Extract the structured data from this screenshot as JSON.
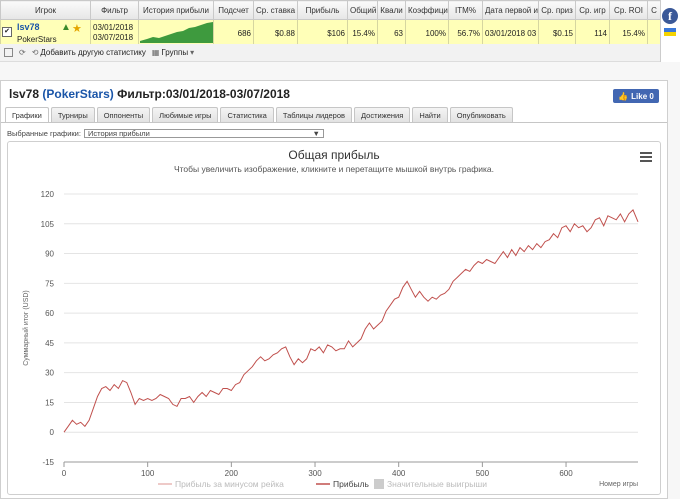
{
  "stats_table": {
    "headers": [
      "Игрок",
      "Фильтр",
      "История прибыли",
      "Подсчет",
      "Ср. ставка",
      "Прибыль",
      "Общий",
      "Квали",
      "Коэффици",
      "ITM%",
      "Дата первой и",
      "Ср. приз",
      "Ср. игр",
      "Ср. ROI",
      "С"
    ],
    "row": {
      "player_name": "lsv78",
      "player_room": "PokerStars",
      "filter_from": "03/01/2018",
      "filter_to": "03/07/2018",
      "count": "686",
      "avg_stake": "$0.88",
      "profit": "$106",
      "total": "15.4%",
      "quali": "63",
      "ratio": "100%",
      "itm": "56.7%",
      "first_date": "03/01/2018 03",
      "avg_prize": "$0.15",
      "avg_games": "114",
      "avg_roi": "15.4%"
    }
  },
  "toolbar": {
    "add_stats_label": "Добавить другую статистику",
    "groups_label": "Группы"
  },
  "side": {
    "fb_letter": "f"
  },
  "panel": {
    "player": "lsv78",
    "room": "(PokerStars)",
    "filter_text": "Фильтр:03/01/2018-03/07/2018",
    "like_label": "Like 0",
    "tabs": [
      "Графики",
      "Турниры",
      "Оппоненты",
      "Любимые игры",
      "Статистика",
      "Таблицы лидеров",
      "Достижения",
      "Найти",
      "Опубликовать"
    ],
    "selected_charts_label": "Выбранные графики:",
    "selected_chart_value": "История прибыли"
  },
  "chart_data": {
    "type": "line",
    "title": "Общая прибыль",
    "subtitle": "Чтобы увеличить изображение, кликните и перетащите мышкой внутрь графика.",
    "ylabel": "Суммарный итог (USD)",
    "xlabel": "Номер игры",
    "xlim": [
      0,
      686
    ],
    "ylim": [
      -15,
      120
    ],
    "x_ticks": [
      0,
      100,
      200,
      300,
      400,
      500,
      600
    ],
    "y_ticks": [
      -15,
      0,
      15,
      30,
      45,
      60,
      75,
      90,
      105,
      120
    ],
    "legend": [
      "Прибыль за минусом рейка",
      "Прибыль",
      "Значительные выигрыши"
    ],
    "grid": true,
    "series": [
      {
        "name": "Прибыль",
        "color": "#c0504d",
        "points": [
          [
            0,
            0
          ],
          [
            5,
            3
          ],
          [
            10,
            6
          ],
          [
            15,
            4
          ],
          [
            20,
            5
          ],
          [
            25,
            3
          ],
          [
            30,
            6
          ],
          [
            35,
            12
          ],
          [
            40,
            18
          ],
          [
            45,
            22
          ],
          [
            50,
            23
          ],
          [
            55,
            21
          ],
          [
            60,
            24
          ],
          [
            65,
            22
          ],
          [
            70,
            26
          ],
          [
            75,
            25
          ],
          [
            80,
            20
          ],
          [
            85,
            14
          ],
          [
            90,
            17
          ],
          [
            95,
            16
          ],
          [
            100,
            17
          ],
          [
            105,
            16
          ],
          [
            110,
            17
          ],
          [
            115,
            19
          ],
          [
            120,
            18
          ],
          [
            125,
            17
          ],
          [
            130,
            14
          ],
          [
            135,
            13
          ],
          [
            140,
            17
          ],
          [
            145,
            17
          ],
          [
            150,
            18
          ],
          [
            155,
            15
          ],
          [
            160,
            18
          ],
          [
            165,
            20
          ],
          [
            170,
            18
          ],
          [
            175,
            21
          ],
          [
            180,
            20
          ],
          [
            185,
            19
          ],
          [
            190,
            22
          ],
          [
            195,
            22
          ],
          [
            200,
            21
          ],
          [
            205,
            24
          ],
          [
            210,
            25
          ],
          [
            215,
            29
          ],
          [
            220,
            31
          ],
          [
            225,
            33
          ],
          [
            230,
            36
          ],
          [
            235,
            38
          ],
          [
            240,
            36
          ],
          [
            245,
            37
          ],
          [
            250,
            39
          ],
          [
            255,
            40
          ],
          [
            260,
            42
          ],
          [
            265,
            43
          ],
          [
            270,
            38
          ],
          [
            275,
            34
          ],
          [
            280,
            37
          ],
          [
            285,
            35
          ],
          [
            290,
            37
          ],
          [
            295,
            42
          ],
          [
            300,
            41
          ],
          [
            305,
            43
          ],
          [
            310,
            40
          ],
          [
            315,
            44
          ],
          [
            320,
            43
          ],
          [
            325,
            41
          ],
          [
            330,
            42
          ],
          [
            335,
            42
          ],
          [
            340,
            46
          ],
          [
            345,
            43
          ],
          [
            350,
            45
          ],
          [
            355,
            47
          ],
          [
            360,
            52
          ],
          [
            365,
            55
          ],
          [
            370,
            52
          ],
          [
            375,
            54
          ],
          [
            380,
            56
          ],
          [
            385,
            61
          ],
          [
            390,
            64
          ],
          [
            395,
            67
          ],
          [
            400,
            68
          ],
          [
            405,
            73
          ],
          [
            410,
            76
          ],
          [
            415,
            72
          ],
          [
            420,
            68
          ],
          [
            425,
            71
          ],
          [
            430,
            68
          ],
          [
            435,
            66
          ],
          [
            440,
            68
          ],
          [
            445,
            67
          ],
          [
            450,
            69
          ],
          [
            455,
            70
          ],
          [
            460,
            72
          ],
          [
            465,
            76
          ],
          [
            470,
            78
          ],
          [
            475,
            80
          ],
          [
            480,
            82
          ],
          [
            485,
            81
          ],
          [
            490,
            84
          ],
          [
            495,
            86
          ],
          [
            500,
            85
          ],
          [
            505,
            87
          ],
          [
            510,
            86
          ],
          [
            515,
            85
          ],
          [
            520,
            88
          ],
          [
            525,
            91
          ],
          [
            530,
            88
          ],
          [
            535,
            92
          ],
          [
            540,
            89
          ],
          [
            545,
            93
          ],
          [
            550,
            91
          ],
          [
            555,
            94
          ],
          [
            560,
            92
          ],
          [
            565,
            95
          ],
          [
            570,
            93
          ],
          [
            575,
            96
          ],
          [
            580,
            97
          ],
          [
            585,
            100
          ],
          [
            590,
            98
          ],
          [
            595,
            103
          ],
          [
            600,
            104
          ],
          [
            605,
            101
          ],
          [
            610,
            105
          ],
          [
            615,
            103
          ],
          [
            620,
            104
          ],
          [
            625,
            101
          ],
          [
            630,
            103
          ],
          [
            635,
            107
          ],
          [
            640,
            108
          ],
          [
            645,
            104
          ],
          [
            650,
            109
          ],
          [
            655,
            108
          ],
          [
            660,
            107
          ],
          [
            665,
            110
          ],
          [
            670,
            106
          ],
          [
            675,
            110
          ],
          [
            680,
            112
          ],
          [
            686,
            106
          ]
        ]
      }
    ]
  }
}
